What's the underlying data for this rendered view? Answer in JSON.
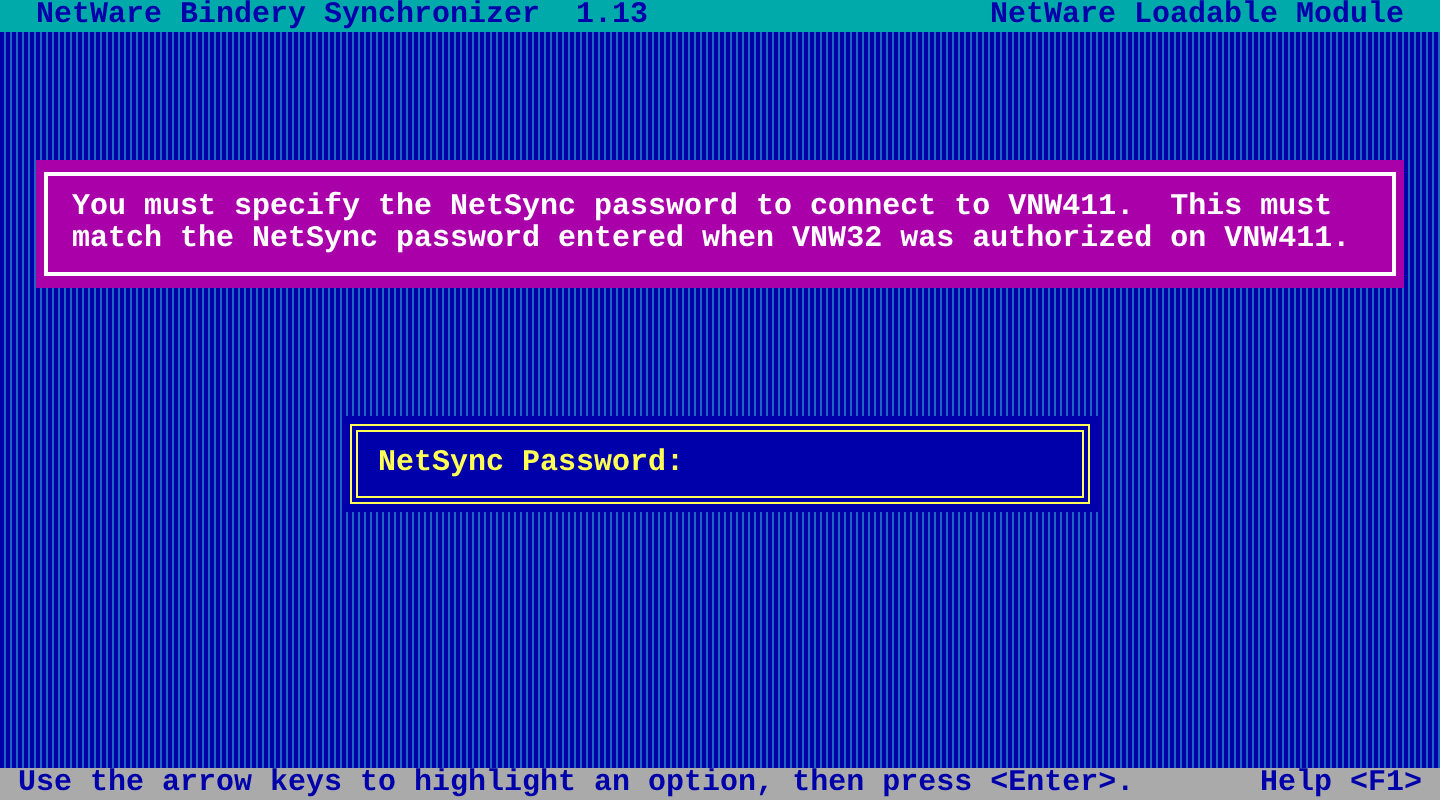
{
  "header": {
    "title": "NetWare Bindery Synchronizer  1.13",
    "module": "NetWare Loadable Module"
  },
  "message": {
    "text": "You must specify the NetSync password to connect to VNW411.  This must match the NetSync password entered when VNW32 was authorized on VNW411."
  },
  "password_dialog": {
    "label": "NetSync Password:"
  },
  "status_bar": {
    "hint": "Use the arrow keys to highlight an option, then press <Enter>.",
    "help": "Help <F1>"
  }
}
